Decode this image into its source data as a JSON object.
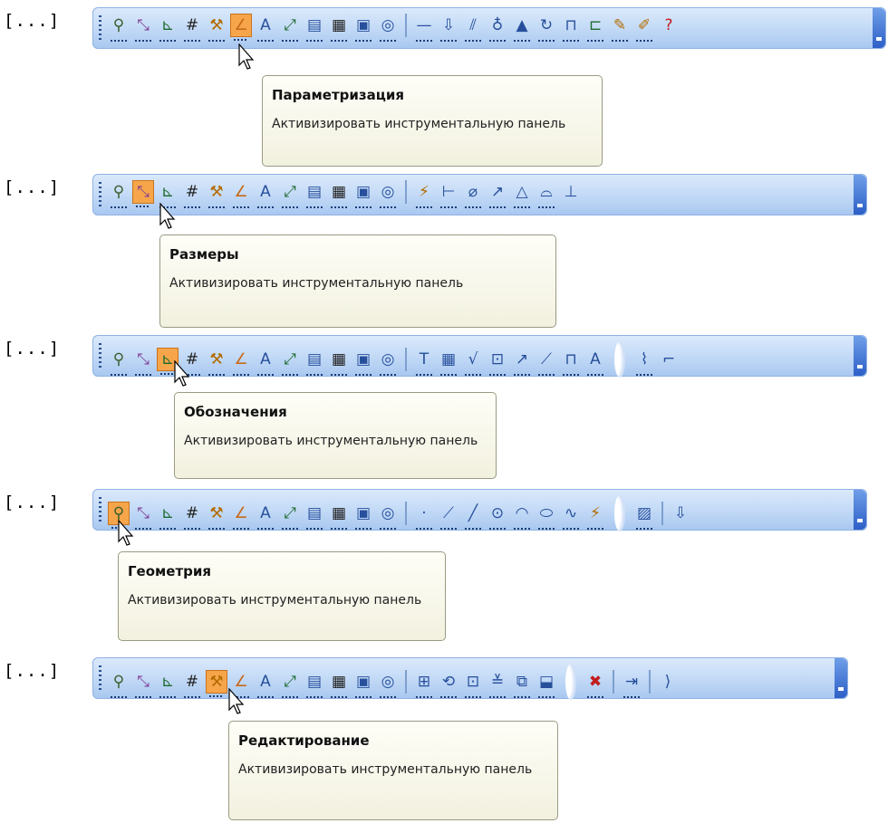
{
  "ellipsis": "[...]",
  "icons": {
    "common": [
      "geometry-icon",
      "dimensions-icon",
      "designations-icon",
      "grid-icon",
      "editing-icon",
      "parametrization-icon",
      "measure-icon",
      "select-icon",
      "spec-icon",
      "report-icon",
      "view-icon",
      "insert-icon"
    ],
    "p1": [
      "horizontal-line-icon",
      "constraint-icon",
      "parallel-icon",
      "tangent-icon",
      "fix-point-icon",
      "angle-icon",
      "dimension-value-icon",
      "constraint-frame-icon",
      "show-constraints-icon",
      "delete-constraints-icon",
      "help-icon"
    ],
    "p2": [
      "auto-dimension-icon",
      "linear-dimension-icon",
      "diameter-dimension-icon",
      "radius-dimension-icon",
      "angular-dimension-icon",
      "arc-dimension-icon",
      "height-dimension-icon"
    ],
    "p3": [
      "text-icon",
      "table-icon",
      "roughness-icon",
      "base-icon",
      "leader-icon",
      "position-leader-icon",
      "tolerance-icon",
      "sign-icon",
      "break-line-icon",
      "arrow-icon"
    ],
    "p4": [
      "point-icon",
      "auxiliary-line-icon",
      "segment-icon",
      "circle-icon",
      "arc-icon",
      "ellipse-icon",
      "spline-icon",
      "polyline-icon",
      "hatch-icon",
      "collection-icon"
    ],
    "p5": [
      "move-icon",
      "rotate-icon",
      "scale-icon",
      "symmetry-icon",
      "copy-icon",
      "deform-icon",
      "delete-icon",
      "cut-icon",
      "split-icon"
    ]
  },
  "tooltips": [
    {
      "title": "Параметризация",
      "description": "Активизировать инструментальную панель"
    },
    {
      "title": "Размеры",
      "description": "Активизировать инструментальную панель"
    },
    {
      "title": "Обозначения",
      "description": "Активизировать инструментальную панель"
    },
    {
      "title": "Геометрия",
      "description": "Активизировать инструментальную панель"
    },
    {
      "title": "Редактирование",
      "description": "Активизировать инструментальную панель"
    }
  ],
  "colors": {
    "toolbar": "#c6dcf7",
    "selected": "#f7a54a",
    "tooltip_bg": "#f7f6e6"
  }
}
